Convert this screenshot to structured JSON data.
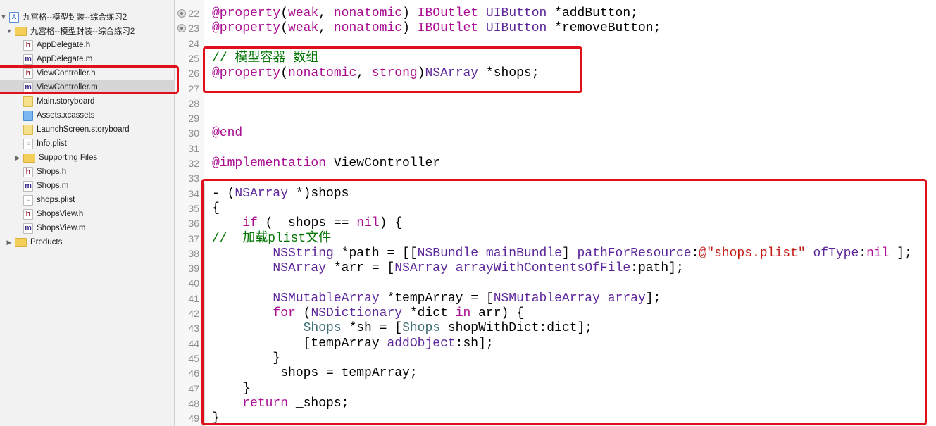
{
  "sidebar": {
    "items": [
      {
        "label": "九宫格--模型封装--综合练习2",
        "icon": "project-icon",
        "indent": 0,
        "tri": "▼",
        "type": "proj"
      },
      {
        "label": "九宫格--模型封装--综合练习2",
        "icon": "folder-icon",
        "indent": 1,
        "tri": "▼",
        "type": "folder"
      },
      {
        "label": "AppDelegate.h",
        "icon": "header-file-icon",
        "indent": 2,
        "type": "h"
      },
      {
        "label": "AppDelegate.m",
        "icon": "implementation-file-icon",
        "indent": 2,
        "type": "m"
      },
      {
        "label": "ViewController.h",
        "icon": "header-file-icon",
        "indent": 2,
        "type": "h"
      },
      {
        "label": "ViewController.m",
        "icon": "implementation-file-icon",
        "indent": 2,
        "type": "m",
        "selected": true
      },
      {
        "label": "Main.storyboard",
        "icon": "storyboard-icon",
        "indent": 2,
        "type": "sb"
      },
      {
        "label": "Assets.xcassets",
        "icon": "assets-icon",
        "indent": 2,
        "type": "assets"
      },
      {
        "label": "LaunchScreen.storyboard",
        "icon": "storyboard-icon",
        "indent": 2,
        "type": "sb"
      },
      {
        "label": "Info.plist",
        "icon": "plist-file-icon",
        "indent": 2,
        "type": "plist"
      },
      {
        "label": "Supporting Files",
        "icon": "folder-icon",
        "indent": 2,
        "tri": "▶",
        "type": "folder"
      },
      {
        "label": "Shops.h",
        "icon": "header-file-icon",
        "indent": 2,
        "type": "h"
      },
      {
        "label": "Shops.m",
        "icon": "implementation-file-icon",
        "indent": 2,
        "type": "m"
      },
      {
        "label": "shops.plist",
        "icon": "plist-file-icon",
        "indent": 2,
        "type": "plist"
      },
      {
        "label": "ShopsView.h",
        "icon": "header-file-icon",
        "indent": 2,
        "type": "h"
      },
      {
        "label": "ShopsView.m",
        "icon": "implementation-file-icon",
        "indent": 2,
        "type": "m"
      },
      {
        "label": "Products",
        "icon": "folder-icon",
        "indent": 1,
        "tri": "▶",
        "type": "folder"
      }
    ]
  },
  "colors": {
    "keyword": "#aa0d91",
    "class": "#5c2699",
    "project_class": "#3f6e74",
    "comment": "#007400",
    "string": "#c41a16",
    "highlight": "#e0101a"
  },
  "editor": {
    "lines": [
      {
        "n": "22",
        "bp": true,
        "t": [
          [
            "kw",
            "@property"
          ],
          [
            "",
            "("
          ],
          [
            "kw",
            "weak"
          ],
          [
            "",
            ", "
          ],
          [
            "kw",
            "nonatomic"
          ],
          [
            "",
            ") "
          ],
          [
            "kw",
            "IBOutlet"
          ],
          [
            "",
            " "
          ],
          [
            "cls",
            "UIButton"
          ],
          [
            "",
            " *addButton;"
          ]
        ]
      },
      {
        "n": "23",
        "bp": true,
        "t": [
          [
            "kw",
            "@property"
          ],
          [
            "",
            "("
          ],
          [
            "kw",
            "weak"
          ],
          [
            "",
            ", "
          ],
          [
            "kw",
            "nonatomic"
          ],
          [
            "",
            ") "
          ],
          [
            "kw",
            "IBOutlet"
          ],
          [
            "",
            " "
          ],
          [
            "cls",
            "UIButton"
          ],
          [
            "",
            " *removeButton;"
          ]
        ]
      },
      {
        "n": "24",
        "t": []
      },
      {
        "n": "25",
        "t": [
          [
            "cm",
            "// 模型容器 数组"
          ]
        ]
      },
      {
        "n": "26",
        "t": [
          [
            "kw",
            "@property"
          ],
          [
            "",
            "("
          ],
          [
            "kw",
            "nonatomic"
          ],
          [
            "",
            ", "
          ],
          [
            "kw",
            "strong"
          ],
          [
            "",
            ")"
          ],
          [
            "cls",
            "NSArray"
          ],
          [
            "",
            " *shops;"
          ]
        ]
      },
      {
        "n": "27",
        "t": []
      },
      {
        "n": "28",
        "t": []
      },
      {
        "n": "29",
        "t": []
      },
      {
        "n": "30",
        "t": [
          [
            "kw",
            "@end"
          ]
        ]
      },
      {
        "n": "31",
        "t": []
      },
      {
        "n": "32",
        "t": [
          [
            "kw",
            "@implementation"
          ],
          [
            "",
            " ViewController"
          ]
        ]
      },
      {
        "n": "33",
        "t": []
      },
      {
        "n": "34",
        "t": [
          [
            "",
            "- ("
          ],
          [
            "cls",
            "NSArray"
          ],
          [
            "",
            " *)shops"
          ]
        ]
      },
      {
        "n": "35",
        "t": [
          [
            "",
            "{"
          ]
        ]
      },
      {
        "n": "36",
        "t": [
          [
            "",
            "    "
          ],
          [
            "kw",
            "if"
          ],
          [
            "",
            " ( _shops == "
          ],
          [
            "kw",
            "nil"
          ],
          [
            "",
            ") {"
          ]
        ]
      },
      {
        "n": "37",
        "t": [
          [
            "cm",
            "//  加载plist文件"
          ]
        ]
      },
      {
        "n": "38",
        "t": [
          [
            "",
            "        "
          ],
          [
            "cls",
            "NSString"
          ],
          [
            "",
            " *path = [["
          ],
          [
            "cls",
            "NSBundle"
          ],
          [
            "",
            " "
          ],
          [
            "cls",
            "mainBundle"
          ],
          [
            "",
            "] "
          ],
          [
            "cls",
            "pathForResource"
          ],
          [
            "",
            ":"
          ],
          [
            "st",
            "@\"shops.plist\""
          ],
          [
            "",
            " "
          ],
          [
            "cls",
            "ofType"
          ],
          [
            "",
            ":"
          ],
          [
            "kw",
            "nil"
          ],
          [
            "",
            " ];"
          ]
        ]
      },
      {
        "n": "39",
        "t": [
          [
            "",
            "        "
          ],
          [
            "cls",
            "NSArray"
          ],
          [
            "",
            " *arr = ["
          ],
          [
            "cls",
            "NSArray"
          ],
          [
            "",
            " "
          ],
          [
            "cls",
            "arrayWithContentsOfFile"
          ],
          [
            "",
            ":path];"
          ]
        ]
      },
      {
        "n": "40",
        "t": []
      },
      {
        "n": "41",
        "t": [
          [
            "",
            "        "
          ],
          [
            "cls",
            "NSMutableArray"
          ],
          [
            "",
            " *tempArray = ["
          ],
          [
            "cls",
            "NSMutableArray"
          ],
          [
            "",
            " "
          ],
          [
            "cls",
            "array"
          ],
          [
            "",
            "];"
          ]
        ]
      },
      {
        "n": "42",
        "t": [
          [
            "",
            "        "
          ],
          [
            "kw",
            "for"
          ],
          [
            "",
            " ("
          ],
          [
            "cls",
            "NSDictionary"
          ],
          [
            "",
            " *dict "
          ],
          [
            "kw",
            "in"
          ],
          [
            "",
            " arr) {"
          ]
        ]
      },
      {
        "n": "43",
        "t": [
          [
            "",
            "            "
          ],
          [
            "pc",
            "Shops"
          ],
          [
            "",
            " *sh = ["
          ],
          [
            "pc",
            "Shops"
          ],
          [
            "",
            " shopWithDict:dict];"
          ]
        ]
      },
      {
        "n": "44",
        "t": [
          [
            "",
            "            [tempArray "
          ],
          [
            "cls",
            "addObject"
          ],
          [
            "",
            ":sh];"
          ]
        ]
      },
      {
        "n": "45",
        "t": [
          [
            "",
            "        }"
          ]
        ]
      },
      {
        "n": "46",
        "t": [
          [
            "",
            "        _shops = tempArray;"
          ]
        ],
        "caret": true
      },
      {
        "n": "47",
        "t": [
          [
            "",
            "    }"
          ]
        ]
      },
      {
        "n": "48",
        "t": [
          [
            "",
            "    "
          ],
          [
            "kw",
            "return"
          ],
          [
            "",
            " _shops;"
          ]
        ]
      },
      {
        "n": "49",
        "t": [
          [
            "",
            "}"
          ]
        ]
      }
    ]
  }
}
